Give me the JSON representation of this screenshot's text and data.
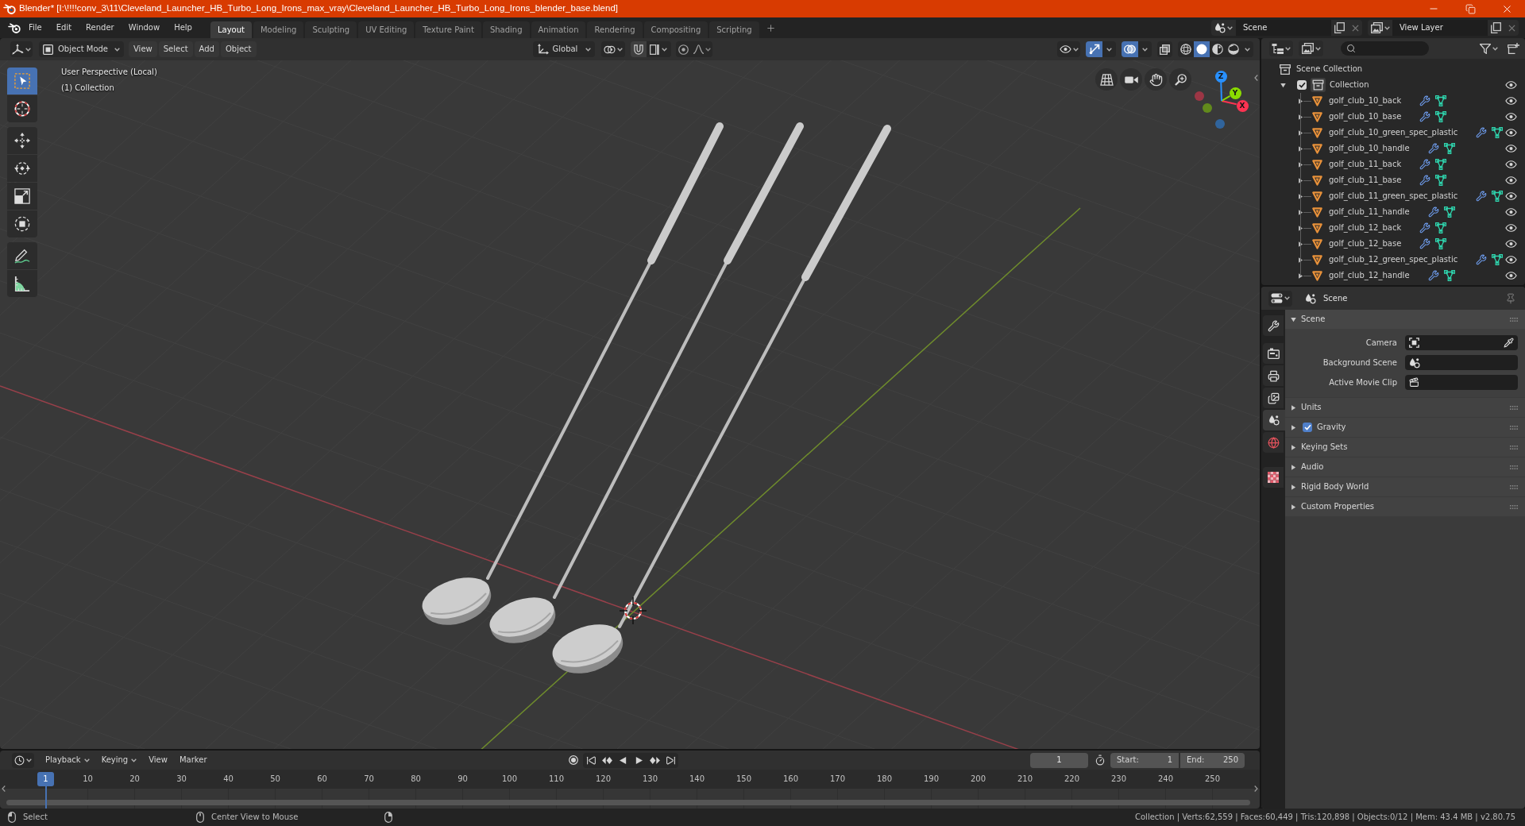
{
  "window": {
    "title": "Blender* [I:\\!!!!conv_3\\11\\Cleveland_Launcher_HB_Turbo_Long_Irons_max_vray\\Cleveland_Launcher_HB_Turbo_Long_Irons_blender_base.blend]"
  },
  "top_bar": {
    "menus": [
      "File",
      "Edit",
      "Render",
      "Window",
      "Help"
    ],
    "workspaces": [
      {
        "label": "Layout",
        "selected": true
      },
      {
        "label": "Modeling",
        "selected": false
      },
      {
        "label": "Sculpting",
        "selected": false
      },
      {
        "label": "UV Editing",
        "selected": false
      },
      {
        "label": "Texture Paint",
        "selected": false
      },
      {
        "label": "Shading",
        "selected": false
      },
      {
        "label": "Animation",
        "selected": false
      },
      {
        "label": "Rendering",
        "selected": false
      },
      {
        "label": "Compositing",
        "selected": false
      },
      {
        "label": "Scripting",
        "selected": false
      }
    ],
    "scene": "Scene",
    "view_layer": "View Layer"
  },
  "viewport": {
    "header": {
      "mode": "Object Mode",
      "menus": [
        "View",
        "Select",
        "Add",
        "Object"
      ],
      "orientation": "Global",
      "toggles": [
        {
          "kind": "gizmo",
          "on": true
        },
        {
          "kind": "overlays",
          "on": true
        },
        {
          "kind": "xray",
          "on": false
        }
      ],
      "shading": [
        {
          "kind": "wireframe",
          "selected": false
        },
        {
          "kind": "solid",
          "selected": true
        },
        {
          "kind": "material",
          "selected": false
        },
        {
          "kind": "rendered",
          "selected": false
        }
      ]
    },
    "info": [
      "User Perspective (Local)",
      "(1) Collection"
    ],
    "tool_groups": [
      [
        {
          "kind": "select_box",
          "selected": true
        },
        {
          "kind": "cursor",
          "selected": false
        }
      ],
      [
        {
          "kind": "move",
          "selected": false
        },
        {
          "kind": "rotate",
          "selected": false
        },
        {
          "kind": "scale",
          "selected": false
        },
        {
          "kind": "transform",
          "selected": false
        }
      ],
      [
        {
          "kind": "annotate",
          "selected": false
        },
        {
          "kind": "measure",
          "selected": false
        }
      ]
    ],
    "nav_gizmo": [
      {
        "label": "X",
        "color": "#ff3352"
      },
      {
        "label": "Y",
        "color": "#8bdc00"
      },
      {
        "label": "Z",
        "color": "#2890ff"
      }
    ]
  },
  "outliner": {
    "root": "Scene Collection",
    "items": [
      {
        "name": "Collection",
        "checked": true,
        "expanded": true,
        "children": [
          {
            "name": "golf_club_10_back",
            "expanded": false
          },
          {
            "name": "golf_club_10_base",
            "expanded": false
          },
          {
            "name": "golf_club_10_green_spec_plastic",
            "expanded": false
          },
          {
            "name": "golf_club_10_handle",
            "expanded": false
          },
          {
            "name": "golf_club_11_back",
            "expanded": false
          },
          {
            "name": "golf_club_11_base",
            "expanded": false
          },
          {
            "name": "golf_club_11_green_spec_plastic",
            "expanded": false
          },
          {
            "name": "golf_club_11_handle",
            "expanded": false
          },
          {
            "name": "golf_club_12_back",
            "expanded": false
          },
          {
            "name": "golf_club_12_base",
            "expanded": false
          },
          {
            "name": "golf_club_12_green_spec_plastic",
            "expanded": false
          },
          {
            "name": "golf_club_12_handle",
            "expanded": false
          }
        ]
      }
    ]
  },
  "properties": {
    "context": "Scene",
    "tab_groups": [
      [
        {
          "kind": "tool",
          "selected": false
        }
      ],
      [
        {
          "kind": "render",
          "selected": false
        },
        {
          "kind": "output",
          "selected": false
        },
        {
          "kind": "view_layer",
          "selected": false
        },
        {
          "kind": "scene",
          "selected": true
        },
        {
          "kind": "world",
          "selected": false
        }
      ],
      [
        {
          "kind": "texture",
          "selected": false
        }
      ]
    ],
    "panel": {
      "title": "Scene",
      "expanded": true,
      "fields": [
        {
          "label": "Camera",
          "kind": "camera"
        },
        {
          "label": "Background Scene",
          "kind": "scene"
        },
        {
          "label": "Active Movie Clip",
          "kind": "clip"
        }
      ]
    },
    "sections": [
      {
        "title": "Units",
        "kind": "panel",
        "expanded": false
      },
      {
        "title": "Gravity",
        "kind": "toggle",
        "checked": true,
        "expanded": false
      },
      {
        "title": "Keying Sets",
        "kind": "panel",
        "expanded": false
      },
      {
        "title": "Audio",
        "kind": "panel",
        "expanded": false
      },
      {
        "title": "Rigid Body World",
        "kind": "panel",
        "expanded": false
      },
      {
        "title": "Custom Properties",
        "kind": "panel",
        "expanded": false
      }
    ]
  },
  "timeline": {
    "menus": [
      {
        "label": "Playback",
        "dropdown": true
      },
      {
        "label": "Keying",
        "dropdown": true
      },
      {
        "label": "View",
        "dropdown": false
      },
      {
        "label": "Marker",
        "dropdown": false
      }
    ],
    "current_frame": "1",
    "start_label": "Start:",
    "start": "1",
    "end_label": "End:",
    "end": "250",
    "ruler": [
      "10",
      "20",
      "30",
      "40",
      "50",
      "60",
      "70",
      "80",
      "90",
      "100",
      "110",
      "120",
      "130",
      "140",
      "150",
      "160",
      "170",
      "180",
      "190",
      "200",
      "210",
      "220",
      "230",
      "240",
      "250"
    ],
    "playhead": "1"
  },
  "status_bar": {
    "hints": [
      {
        "kind": "left",
        "label": "Select"
      },
      {
        "kind": "middle",
        "label": "Center View to Mouse"
      },
      {
        "kind": "right"
      }
    ],
    "stats": "Collection | Verts:62,559 | Faces:60,449 | Tris:120,898 | Objects:0/12 | Mem: 43.4 MB | v2.80.75"
  }
}
